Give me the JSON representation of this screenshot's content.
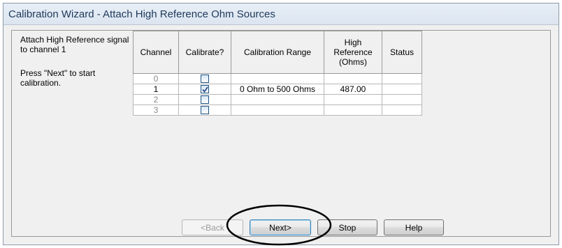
{
  "window": {
    "title": "Calibration Wizard - Attach High Reference Ohm Sources"
  },
  "instructions": {
    "attach": "Attach High Reference signal to channel 1",
    "press": "Press \"Next\" to start calibration."
  },
  "table": {
    "headers": {
      "channel": "Channel",
      "calibrate": "Calibrate?",
      "range": "Calibration Range",
      "reference": "High Reference (Ohms)",
      "status": "Status"
    },
    "rows": [
      {
        "channel": "0",
        "calibrate": false,
        "range": "",
        "reference": "",
        "status": ""
      },
      {
        "channel": "1",
        "calibrate": true,
        "range": "0 Ohm to 500 Ohms",
        "reference": "487.00",
        "status": ""
      },
      {
        "channel": "2",
        "calibrate": false,
        "range": "",
        "reference": "",
        "status": ""
      },
      {
        "channel": "3",
        "calibrate": false,
        "range": "",
        "reference": "",
        "status": ""
      }
    ]
  },
  "buttons": {
    "back": "<Back",
    "next": "Next>",
    "stop": "Stop",
    "help": "Help"
  },
  "annotation": {
    "shape": "ellipse",
    "target": "next-button",
    "color": "#000000"
  },
  "icons": {
    "checkbox_checked": "checkmark-icon"
  }
}
